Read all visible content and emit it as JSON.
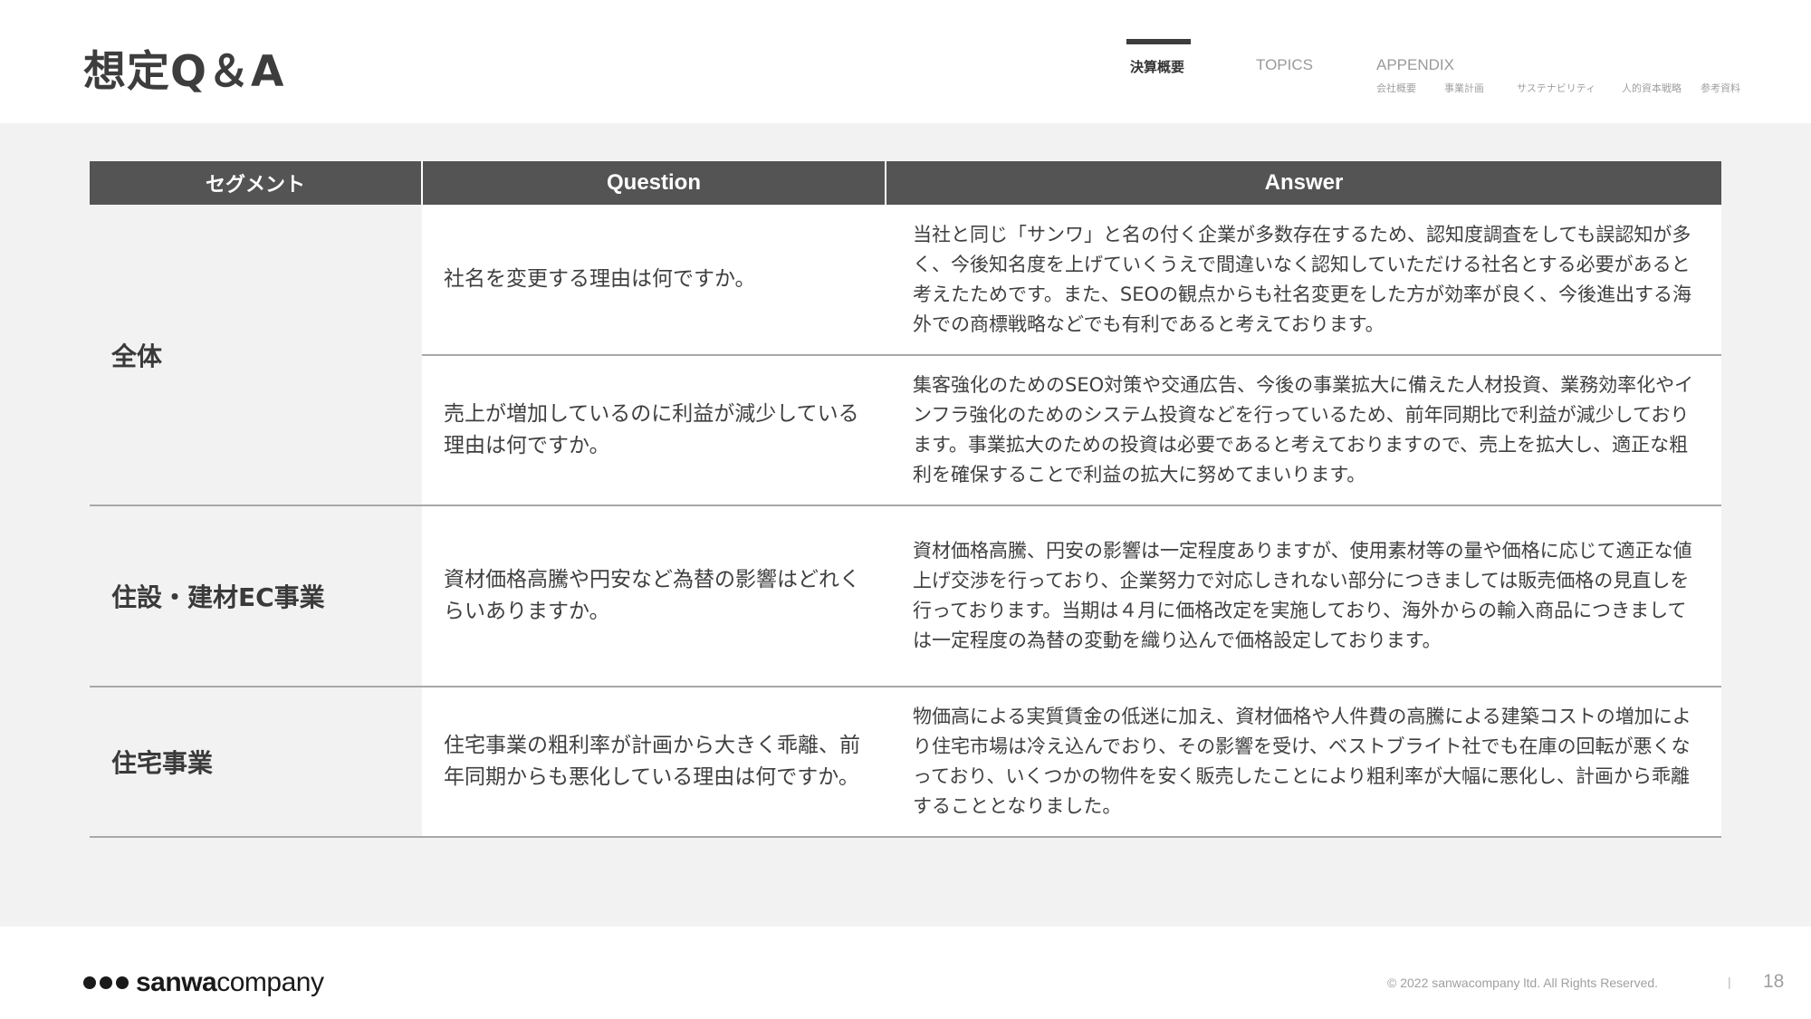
{
  "header": {
    "title": "想定Q＆A",
    "nav": {
      "tabs": [
        {
          "label": "決算概要",
          "active": true
        },
        {
          "label": "TOPICS",
          "active": false
        },
        {
          "label": "APPENDIX",
          "active": false
        }
      ],
      "appendix_items": [
        "会社概要",
        "事業計画",
        "サステナビリティ",
        "人的資本戦略",
        "参考資料"
      ]
    }
  },
  "table": {
    "headers": {
      "segment": "セグメント",
      "question": "Question",
      "answer": "Answer"
    },
    "groups": [
      {
        "segment": "全体",
        "rows": [
          {
            "question": "社名を変更する理由は何ですか。",
            "answer": "当社と同じ「サンワ」と名の付く企業が多数存在するため、認知度調査をしても誤認知が多く、今後知名度を上げていくうえで間違いなく認知していただける社名とする必要があると考えたためです。また、SEOの観点からも社名変更をした方が効率が良く、今後進出する海外での商標戦略などでも有利であると考えております。"
          },
          {
            "question": "売上が増加しているのに利益が減少している理由は何ですか。",
            "answer": "集客強化のためのSEO対策や交通広告、今後の事業拡大に備えた人材投資、業務効率化やインフラ強化のためのシステム投資などを行っているため、前年同期比で利益が減少しております。事業拡大のための投資は必要であると考えておりますので、売上を拡大し、適正な粗利を確保することで利益の拡大に努めてまいります。"
          }
        ]
      },
      {
        "segment": "住設・建材EC事業",
        "rows": [
          {
            "question": "資材価格高騰や円安など為替の影響はどれくらいありますか。",
            "answer": "資材価格高騰、円安の影響は一定程度ありますが、使用素材等の量や価格に応じて適正な値上げ交渉を行っており、企業努力で対応しきれない部分につきましては販売価格の見直しを行っております。当期は４月に価格改定を実施しており、海外からの輸入商品につきましては一定程度の為替の変動を織り込んで価格設定しております。"
          }
        ]
      },
      {
        "segment": "住宅事業",
        "rows": [
          {
            "question": "住宅事業の粗利率が計画から大きく乖離、前年同期からも悪化している理由は何ですか。",
            "answer": "物価高による実質賃金の低迷に加え、資材価格や人件費の高騰による建築コストの増加により住宅市場は冷え込んでおり、その影響を受け、ベストブライト社でも在庫の回転が悪くなっており、いくつかの物件を安く販売したことにより粗利率が大幅に悪化し、計画から乖離することとなりました。"
          }
        ]
      }
    ]
  },
  "footer": {
    "logo_bold": "sanwa",
    "logo_light": "company",
    "copyright": "© 2022 sanwacompany ltd. All Rights Reserved.",
    "separator": "|",
    "page_number": "18"
  },
  "colors": {
    "header_cell_bg": "#545454",
    "content_bg": "#f3f2f2",
    "text": "#3f3f3f"
  }
}
